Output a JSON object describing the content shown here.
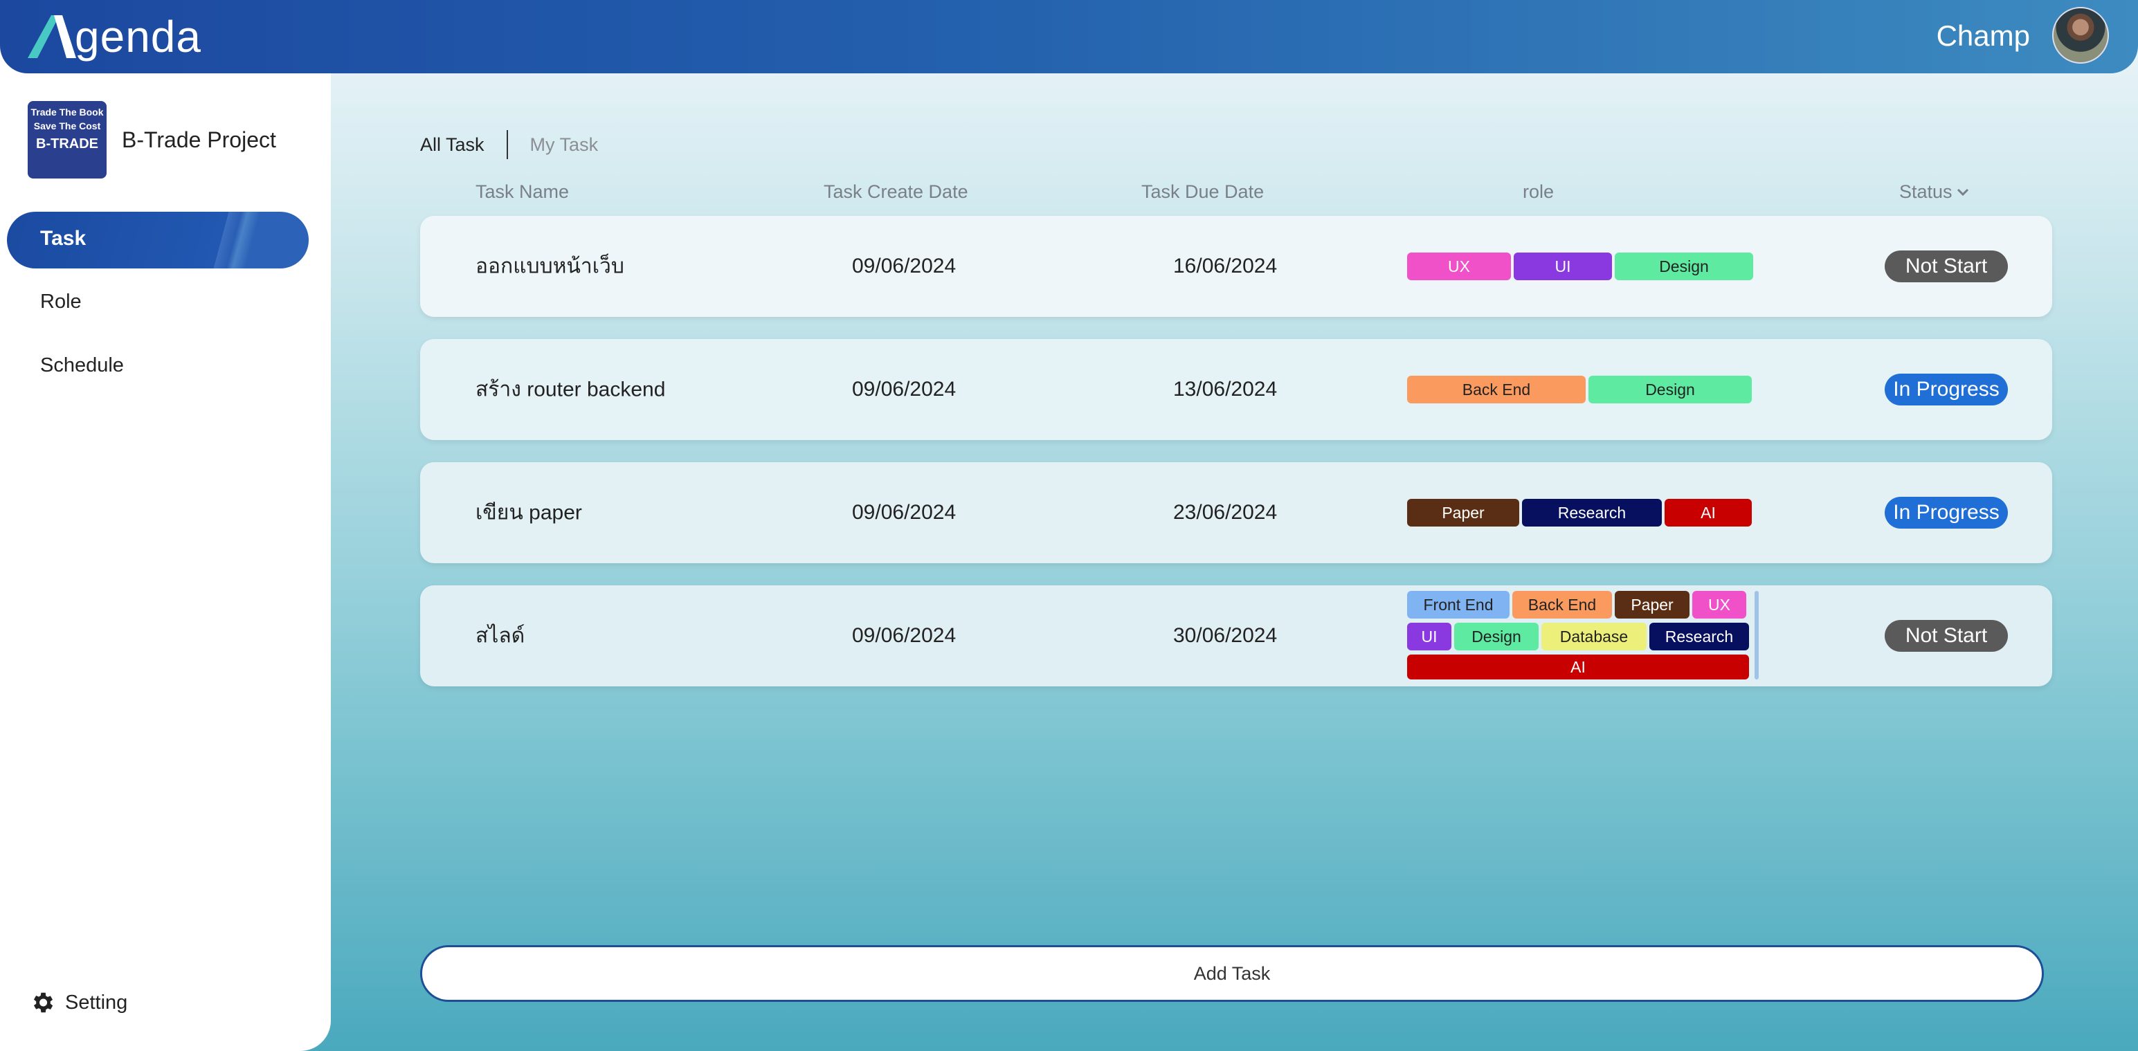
{
  "app": {
    "logo_text": "genda",
    "user_name": "Champ"
  },
  "sidebar": {
    "project_logo_lines": [
      "Trade The Book",
      "Save The Cost",
      "B-TRADE"
    ],
    "project_name": "B-Trade Project",
    "items": [
      {
        "label": "Task",
        "active": true
      },
      {
        "label": "Role",
        "active": false
      },
      {
        "label": "Schedule",
        "active": false
      }
    ],
    "setting_label": "Setting"
  },
  "main": {
    "tabs": [
      {
        "label": "All Task"
      },
      {
        "label": "My Task"
      }
    ],
    "columns": {
      "name": "Task Name",
      "created": "Task Create Date",
      "due": "Task Due Date",
      "role": "role",
      "status": "Status"
    },
    "tasks": [
      {
        "name": "ออกแบบหน้าเว็บ",
        "created": "09/06/2024",
        "due": "16/06/2024",
        "roles": [
          {
            "label": "UX"
          },
          {
            "label": "UI"
          },
          {
            "label": "Design"
          }
        ],
        "status": "Not Start"
      },
      {
        "name": "สร้าง router backend",
        "created": "09/06/2024",
        "due": "13/06/2024",
        "roles": [
          {
            "label": "Back End"
          },
          {
            "label": "Design"
          }
        ],
        "status": "In Progress"
      },
      {
        "name": "เขียน paper",
        "created": "09/06/2024",
        "due": "23/06/2024",
        "roles": [
          {
            "label": "Paper"
          },
          {
            "label": "Research"
          },
          {
            "label": "AI"
          }
        ],
        "status": "In Progress"
      },
      {
        "name": "สไลด์",
        "created": "09/06/2024",
        "due": "30/06/2024",
        "roles": [
          {
            "label": "Front End"
          },
          {
            "label": "Back End"
          },
          {
            "label": "Paper"
          },
          {
            "label": "UX"
          },
          {
            "label": "UI"
          },
          {
            "label": "Design"
          },
          {
            "label": "Database"
          },
          {
            "label": "Research"
          },
          {
            "label": "AI"
          }
        ],
        "status": "Not Start"
      }
    ],
    "add_task_label": "Add Task"
  },
  "colors": {
    "header_start": "#1c48a0",
    "header_end": "#3d8bc0",
    "role": {
      "UX": "#f050c8",
      "UI": "#8a38e0",
      "Design": "#5eeaa0",
      "Back End": "#fb9a5e",
      "Paper": "#5a2e14",
      "Research": "#07105e",
      "AI": "#c80000",
      "Front End": "#7fb3f2",
      "Database": "#ecf07a"
    },
    "status": {
      "Not Start": "#5a5a5a",
      "In Progress": "#1f6fd6"
    }
  }
}
